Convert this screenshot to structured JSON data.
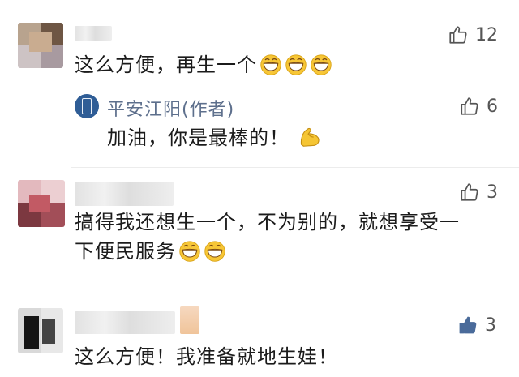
{
  "comments": [
    {
      "text": "这么方便，再生一个",
      "like_count": "12",
      "reply": {
        "author": "平安江阳(作者)",
        "text": "加油，你是最棒的！",
        "like_count": "6"
      }
    },
    {
      "text_line1": "搞得我还想生一个，不为别的，就想享受一",
      "text_line2": "下便民服务",
      "like_count": "3"
    },
    {
      "text": "这么方便！我准备就地生娃！",
      "like_count": "3",
      "liked": true
    }
  ],
  "colors": {
    "author_name": "#5d6f8c",
    "like_icon": "#555555",
    "liked_icon": "#4a6b9a"
  },
  "icons": [
    "thumbs-up-icon",
    "thumbs-up-filled-icon",
    "grinning-emoji-icon",
    "flexed-biceps-emoji-icon"
  ]
}
